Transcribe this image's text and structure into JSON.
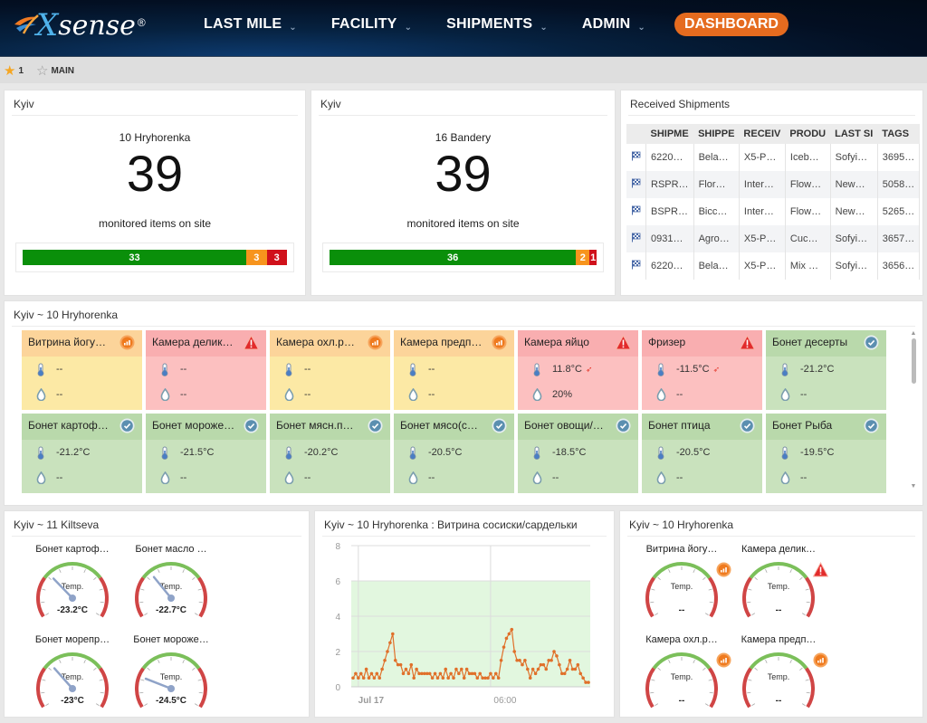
{
  "header": {
    "logo_text_x": "X",
    "logo_text_rest": "sense",
    "logo_reg": "®",
    "nav": [
      {
        "label": "LAST MILE",
        "has_dropdown": true
      },
      {
        "label": "FACILITY",
        "has_dropdown": true
      },
      {
        "label": "SHIPMENTS",
        "has_dropdown": true
      },
      {
        "label": "ADMIN",
        "has_dropdown": true
      }
    ],
    "active_button": "DASHBOARD",
    "chevron": "⌄"
  },
  "subbar": {
    "items": [
      {
        "icon": "star-filled-icon",
        "label": "1"
      },
      {
        "icon": "star-empty-icon",
        "label": "MAIN"
      }
    ]
  },
  "colors": {
    "accent": "#e56b1f",
    "ok": "#0a8f0a",
    "warn": "#f7941d",
    "alarm": "#d0111b",
    "tile_yellow": "#fce9a5",
    "tile_red": "#fcc0c0",
    "tile_green": "#c9e2bd"
  },
  "site_panels": [
    {
      "title": "Kyiv",
      "site": "10 Hryhorenka",
      "count": "39",
      "description": "monitored items on site",
      "breakdown": [
        {
          "status": "ok",
          "value": 33
        },
        {
          "status": "warning",
          "value": 3
        },
        {
          "status": "alarm",
          "value": 3
        }
      ]
    },
    {
      "title": "Kyiv",
      "site": "16 Bandery",
      "count": "39",
      "description": "monitored items on site",
      "breakdown": [
        {
          "status": "ok",
          "value": 36
        },
        {
          "status": "warning",
          "value": 2
        },
        {
          "status": "alarm",
          "value": 1
        }
      ]
    }
  ],
  "shipments": {
    "title": "Received Shipments",
    "columns": [
      "",
      "SHIPME",
      "SHIPPE",
      "RECEIV",
      "PRODU",
      "LAST SI",
      "TAGS"
    ],
    "rows": [
      [
        "flag",
        "6220…",
        "Bela…",
        "X5-P…",
        "Iceb…",
        "Sofyi…",
        "3695…"
      ],
      [
        "flag",
        "RSPR…",
        "Flor…",
        "Inter…",
        "Flow…",
        "New…",
        "5058…"
      ],
      [
        "flag",
        "BSPR…",
        "Bicc…",
        "Inter…",
        "Flow…",
        "New…",
        "5265…"
      ],
      [
        "flag",
        "0931…",
        "Agro…",
        "X5-P…",
        "Cuc…",
        "Sofyi…",
        "3657…"
      ],
      [
        "flag",
        "6220…",
        "Bela…",
        "X5-P…",
        "Mix …",
        "Sofyi…",
        "3656…"
      ]
    ]
  },
  "sensors_panel": {
    "title": "Kyiv ~ 10 Hryhorenka",
    "tiles": [
      {
        "name": "Витрина йогу…",
        "state": "yellow",
        "status_icon": "signal-warning-icon",
        "temp": "--",
        "humidity": "--",
        "temp_alarm": false
      },
      {
        "name": "Камера делик…",
        "state": "red",
        "status_icon": "alert-triangle-icon",
        "temp": "--",
        "humidity": "--",
        "temp_alarm": false
      },
      {
        "name": "Камера охл.р…",
        "state": "yellow",
        "status_icon": "signal-warning-icon",
        "temp": "--",
        "humidity": "--",
        "temp_alarm": false
      },
      {
        "name": "Камера предп…",
        "state": "yellow",
        "status_icon": "signal-warning-icon",
        "temp": "--",
        "humidity": "--",
        "temp_alarm": false
      },
      {
        "name": "Камера яйцо",
        "state": "red",
        "status_icon": "alert-triangle-icon",
        "temp": "11.8°C",
        "humidity": "20%",
        "temp_alarm": true
      },
      {
        "name": "Фризер",
        "state": "red",
        "status_icon": "alert-triangle-icon",
        "temp": "-11.5°C",
        "humidity": "--",
        "temp_alarm": true
      },
      {
        "name": "Бонет десерты",
        "state": "green",
        "status_icon": "check-circle-icon",
        "temp": "-21.2°C",
        "humidity": "--",
        "temp_alarm": false
      },
      {
        "name": "Бонет картоф…",
        "state": "green",
        "status_icon": "check-circle-icon",
        "temp": "-21.2°C",
        "humidity": "--",
        "temp_alarm": false
      },
      {
        "name": "Бонет мороже…",
        "state": "green",
        "status_icon": "check-circle-icon",
        "temp": "-21.5°C",
        "humidity": "--",
        "temp_alarm": false
      },
      {
        "name": "Бонет мясн.п…",
        "state": "green",
        "status_icon": "check-circle-icon",
        "temp": "-20.2°C",
        "humidity": "--",
        "temp_alarm": false
      },
      {
        "name": "Бонет мясо(с…",
        "state": "green",
        "status_icon": "check-circle-icon",
        "temp": "-20.5°C",
        "humidity": "--",
        "temp_alarm": false
      },
      {
        "name": "Бонет овощи/…",
        "state": "green",
        "status_icon": "check-circle-icon",
        "temp": "-18.5°C",
        "humidity": "--",
        "temp_alarm": false
      },
      {
        "name": "Бонет птица",
        "state": "green",
        "status_icon": "check-circle-icon",
        "temp": "-20.5°C",
        "humidity": "--",
        "temp_alarm": false
      },
      {
        "name": "Бонет Рыба",
        "state": "green",
        "status_icon": "check-circle-icon",
        "temp": "-19.5°C",
        "humidity": "--",
        "temp_alarm": false
      }
    ]
  },
  "gauges_kiltseva": {
    "title": "Kyiv ~ 11 Kiltseva",
    "gauge_label": "Temp.",
    "gauges": [
      {
        "name": "Бонет картоф…",
        "value": "-23.2°C",
        "needle": 0.32,
        "badge": null
      },
      {
        "name": "Бонет масло …",
        "value": "-22.7°C",
        "needle": 0.34,
        "badge": null
      },
      {
        "name": "Бонет морепр…",
        "value": "-23°C",
        "needle": 0.33,
        "badge": null
      },
      {
        "name": "Бонет мороже…",
        "value": "-24.5°C",
        "needle": 0.22,
        "badge": null
      }
    ]
  },
  "gauges_hryhorenka": {
    "title": "Kyiv ~ 10 Hryhorenka",
    "gauge_label": "Temp.",
    "gauges": [
      {
        "name": "Витрина йогу…",
        "value": "--",
        "needle": null,
        "badge": "signal-warning-icon"
      },
      {
        "name": "Камера делик…",
        "value": "--",
        "needle": null,
        "badge": "alert-triangle-icon"
      },
      {
        "name": "Камера охл.р…",
        "value": "--",
        "needle": null,
        "badge": "signal-warning-icon"
      },
      {
        "name": "Камера предп…",
        "value": "--",
        "needle": null,
        "badge": "signal-warning-icon"
      }
    ]
  },
  "chart_panel": {
    "title": "Kyiv ~ 10 Hryhorenka : Витрина сосиски/сардельки"
  },
  "chart_data": {
    "type": "line",
    "title": "Kyiv ~ 10 Hryhorenka : Витрина сосиски/сардельки",
    "xlabel": "",
    "ylabel": "",
    "ylim": [
      0,
      8
    ],
    "yticks": [
      0,
      2,
      4,
      6,
      8
    ],
    "xtick_labels": [
      {
        "label": "Jul 17",
        "index": 2
      },
      {
        "label": "06:00",
        "index": 52
      }
    ],
    "band": {
      "from": 0,
      "to": 6,
      "color": "#e2f7df"
    },
    "grid": true,
    "series": [
      {
        "name": "Temperature",
        "color": "#e0702a",
        "values": [
          0.5,
          0.75,
          0.5,
          0.75,
          0.5,
          1.0,
          0.5,
          0.75,
          0.5,
          0.75,
          0.5,
          1.0,
          1.5,
          2.0,
          2.5,
          3.0,
          1.5,
          1.25,
          1.25,
          0.75,
          1.0,
          0.75,
          1.25,
          0.5,
          1.0,
          0.75,
          0.75,
          0.75,
          0.75,
          0.75,
          0.5,
          0.75,
          0.5,
          0.75,
          0.5,
          1.0,
          0.5,
          0.75,
          0.5,
          1.0,
          0.75,
          1.0,
          0.5,
          1.0,
          0.75,
          0.75,
          0.75,
          0.5,
          0.75,
          0.5,
          0.5,
          0.5,
          0.75,
          0.5,
          0.75,
          0.5,
          1.5,
          2.25,
          2.75,
          3.0,
          3.25,
          2.0,
          1.5,
          1.5,
          1.25,
          1.5,
          1.0,
          0.5,
          1.0,
          0.75,
          1.0,
          1.25,
          1.25,
          1.0,
          1.5,
          1.5,
          2.0,
          1.75,
          1.25,
          0.75,
          0.75,
          1.0,
          1.5,
          1.0,
          1.0,
          1.25,
          0.75,
          0.5,
          0.25,
          0.25
        ]
      }
    ]
  }
}
